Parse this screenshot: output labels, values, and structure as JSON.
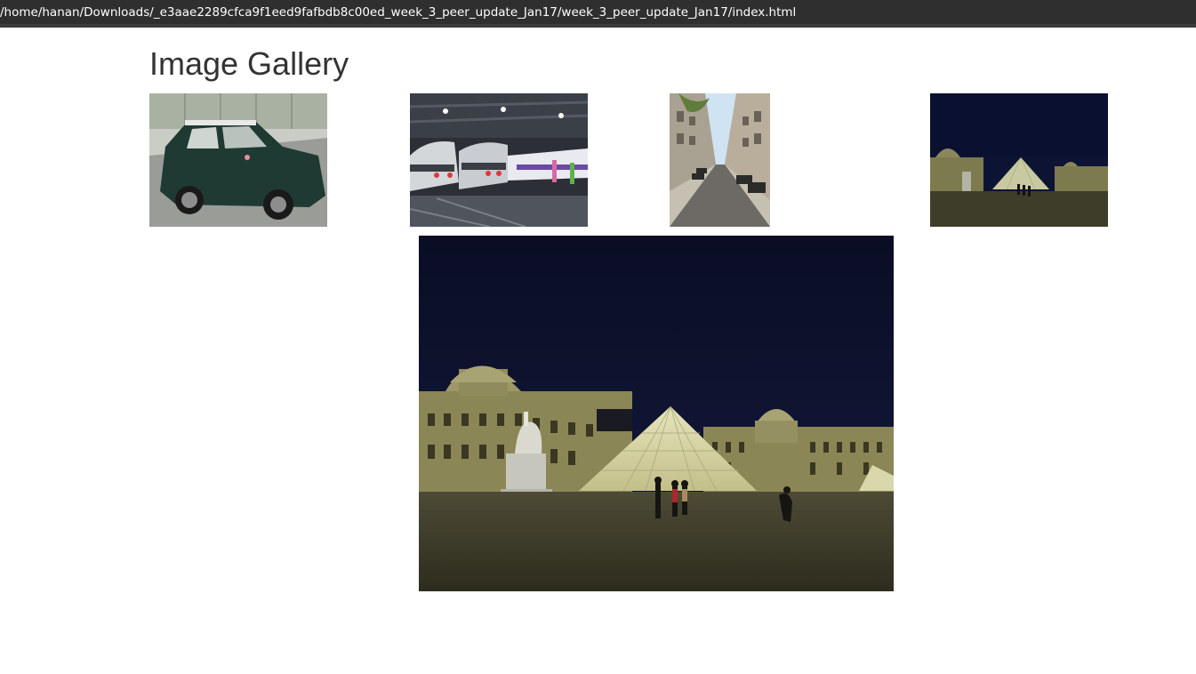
{
  "window": {
    "path": "/home/hanan/Downloads/_e3aae2289cfca9f1eed9fafbdb8c00ed_week_3_peer_update_Jan17/week_3_peer_update_Jan17/index.html"
  },
  "gallery": {
    "title": "Image Gallery",
    "thumbnails": [
      {
        "subject": "vintage-green-mini-car"
      },
      {
        "subject": "tgv-trains-in-station"
      },
      {
        "subject": "parisian-street"
      },
      {
        "subject": "louvre-pyramid-at-night"
      }
    ],
    "selected": {
      "subject": "louvre-pyramid-at-night"
    }
  }
}
